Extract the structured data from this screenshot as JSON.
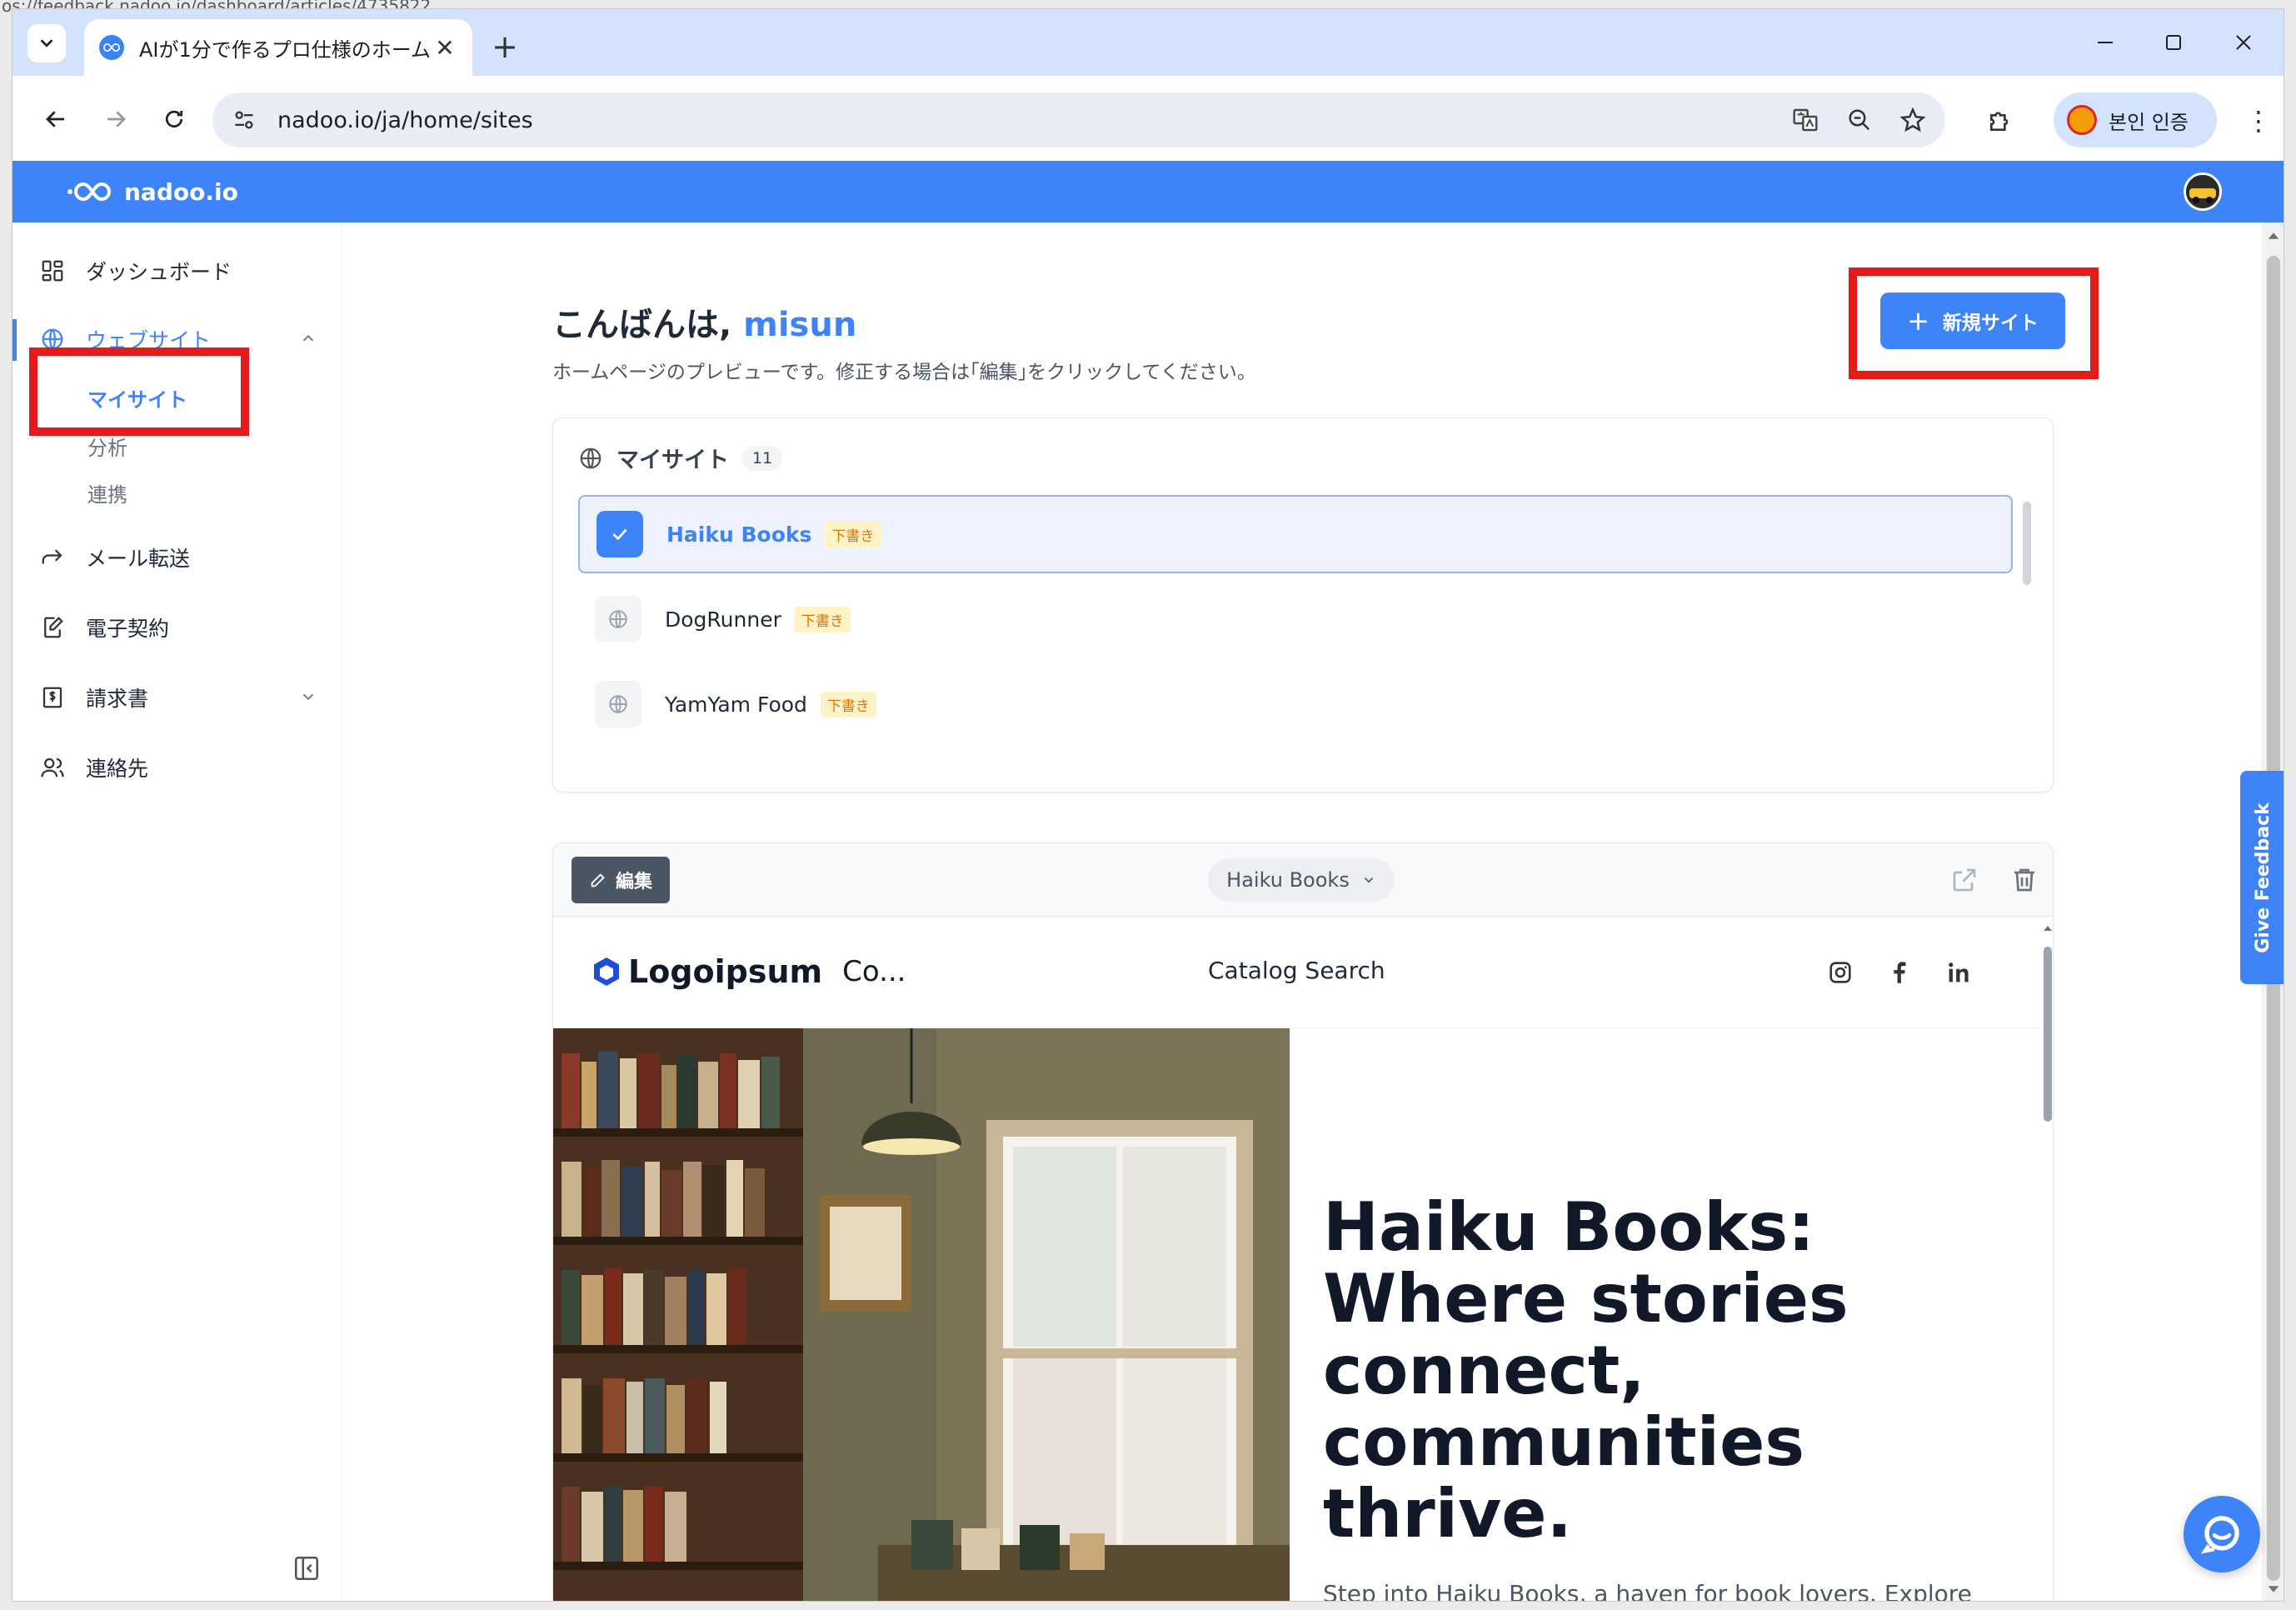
{
  "address_overflow": "os://feedback.nadoo.io/dashboard/articles/4735822",
  "tab": {
    "title": "AIが1分で作るプロ仕様のホーム"
  },
  "toolbar": {
    "url": "nadoo.io/ja/home/sites",
    "profile_label": "본인 인증"
  },
  "app": {
    "brand": "nadoo.io"
  },
  "sidebar": {
    "items": [
      {
        "label": "ダッシュボード"
      },
      {
        "label": "ウェブサイト"
      },
      {
        "label": "メール転送"
      },
      {
        "label": "電子契約"
      },
      {
        "label": "請求書"
      },
      {
        "label": "連絡先"
      }
    ],
    "subitems": [
      {
        "label": "マイサイト"
      },
      {
        "label": "分析"
      },
      {
        "label": "連携"
      }
    ]
  },
  "main": {
    "greeting": "こんばんは,",
    "username": "misun",
    "subtitle": "ホームページのプレビューです。修正する場合は｢編集｣をクリックしてください。",
    "new_site_button": "新規サイト"
  },
  "sites_card": {
    "title": "マイサイト",
    "count": "11",
    "sites": [
      {
        "name": "Haiku Books",
        "status": "下書き"
      },
      {
        "name": "DogRunner",
        "status": "下書き"
      },
      {
        "name": "YamYam Food",
        "status": "下書き"
      }
    ]
  },
  "preview": {
    "edit_button": "編集",
    "selected_site": "Haiku Books",
    "logo_text": "Logoipsum",
    "logo_suffix": "Co...",
    "nav_link": "Catalog Search",
    "hero_title": "Haiku Books: Where stories connect, communities thrive.",
    "hero_text": "Step into Haiku Books, a haven for book lovers. Explore"
  },
  "feedback": {
    "label": "Give Feedback"
  },
  "colors": {
    "accent": "#3f83f8",
    "highlight": "#e41b1b",
    "draft_badge": "#fef3c7"
  }
}
